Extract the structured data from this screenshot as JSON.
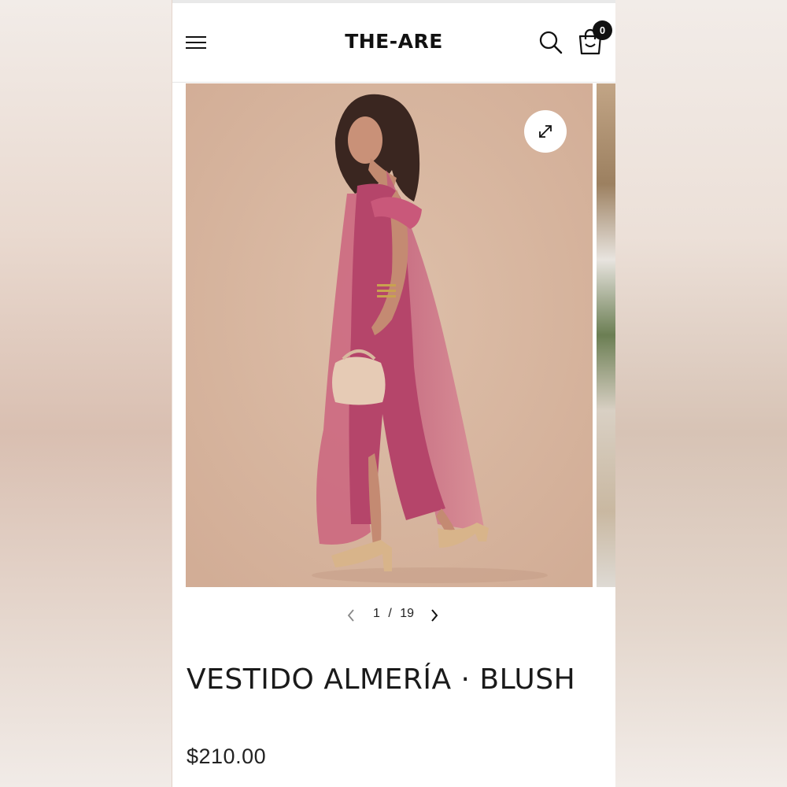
{
  "header": {
    "brand": "THE-ARE",
    "cart_count": "0"
  },
  "icons": {
    "menu": "hamburger-icon",
    "search": "search-icon",
    "cart": "shopping-bag-icon",
    "expand": "expand-icon",
    "prev": "chevron-left-icon",
    "next": "chevron-right-icon"
  },
  "gallery": {
    "current": "1",
    "separator": "/",
    "total": "19"
  },
  "product": {
    "title": "VESTIDO ALMERÍA · BLUSH",
    "price": "$210.00"
  },
  "colors": {
    "background": "#ffffff",
    "text": "#111111",
    "image_backdrop": "#d7b59f",
    "dress": "#b8466a",
    "badge": "#111111"
  }
}
